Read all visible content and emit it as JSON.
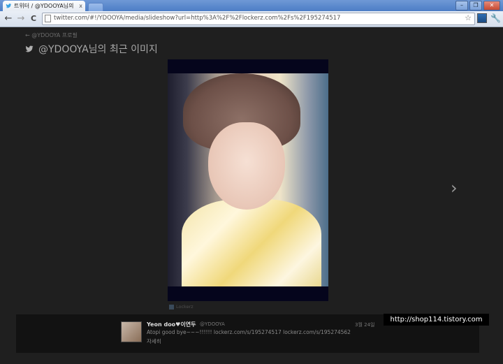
{
  "browser": {
    "tab_title": "트위터 / @YDOOYA님의",
    "tab_close": "x",
    "url": "twitter.com/#!/YDOOYA/media/slideshow?url=http%3A%2F%2Flockerz.com%2Fs%2F195274517",
    "back_glyph": "←",
    "forward_glyph": "→",
    "reload_glyph": "C",
    "star_glyph": "☆",
    "wrench_glyph": "🔧",
    "window_buttons": [
      "–",
      "❐",
      "✕"
    ]
  },
  "page": {
    "back_link": "← @YDOOYA 프로필",
    "title": "@YDOOYA님의 최근 이미지",
    "next_arrow": "›",
    "photo_source": "Lockerz",
    "icons": {
      "bird": "twitter-bird-icon",
      "next": "chevron-right-icon",
      "source": "lockerz-icon"
    }
  },
  "tweet": {
    "name": "Yeon doo♥이연두",
    "handle": "@YDOOYA",
    "date": "3월 24일",
    "text": "Atopi good bye~~~!!!!!! lockerz.com/s/195274517 lockerz.com/s/195274562",
    "detail": "자세히"
  },
  "watermark": "http://shop114.tistory.com",
  "colors": {
    "background": "#1f1f1f",
    "tweet_panel": "#121212",
    "title_text": "#a8a8a8"
  }
}
